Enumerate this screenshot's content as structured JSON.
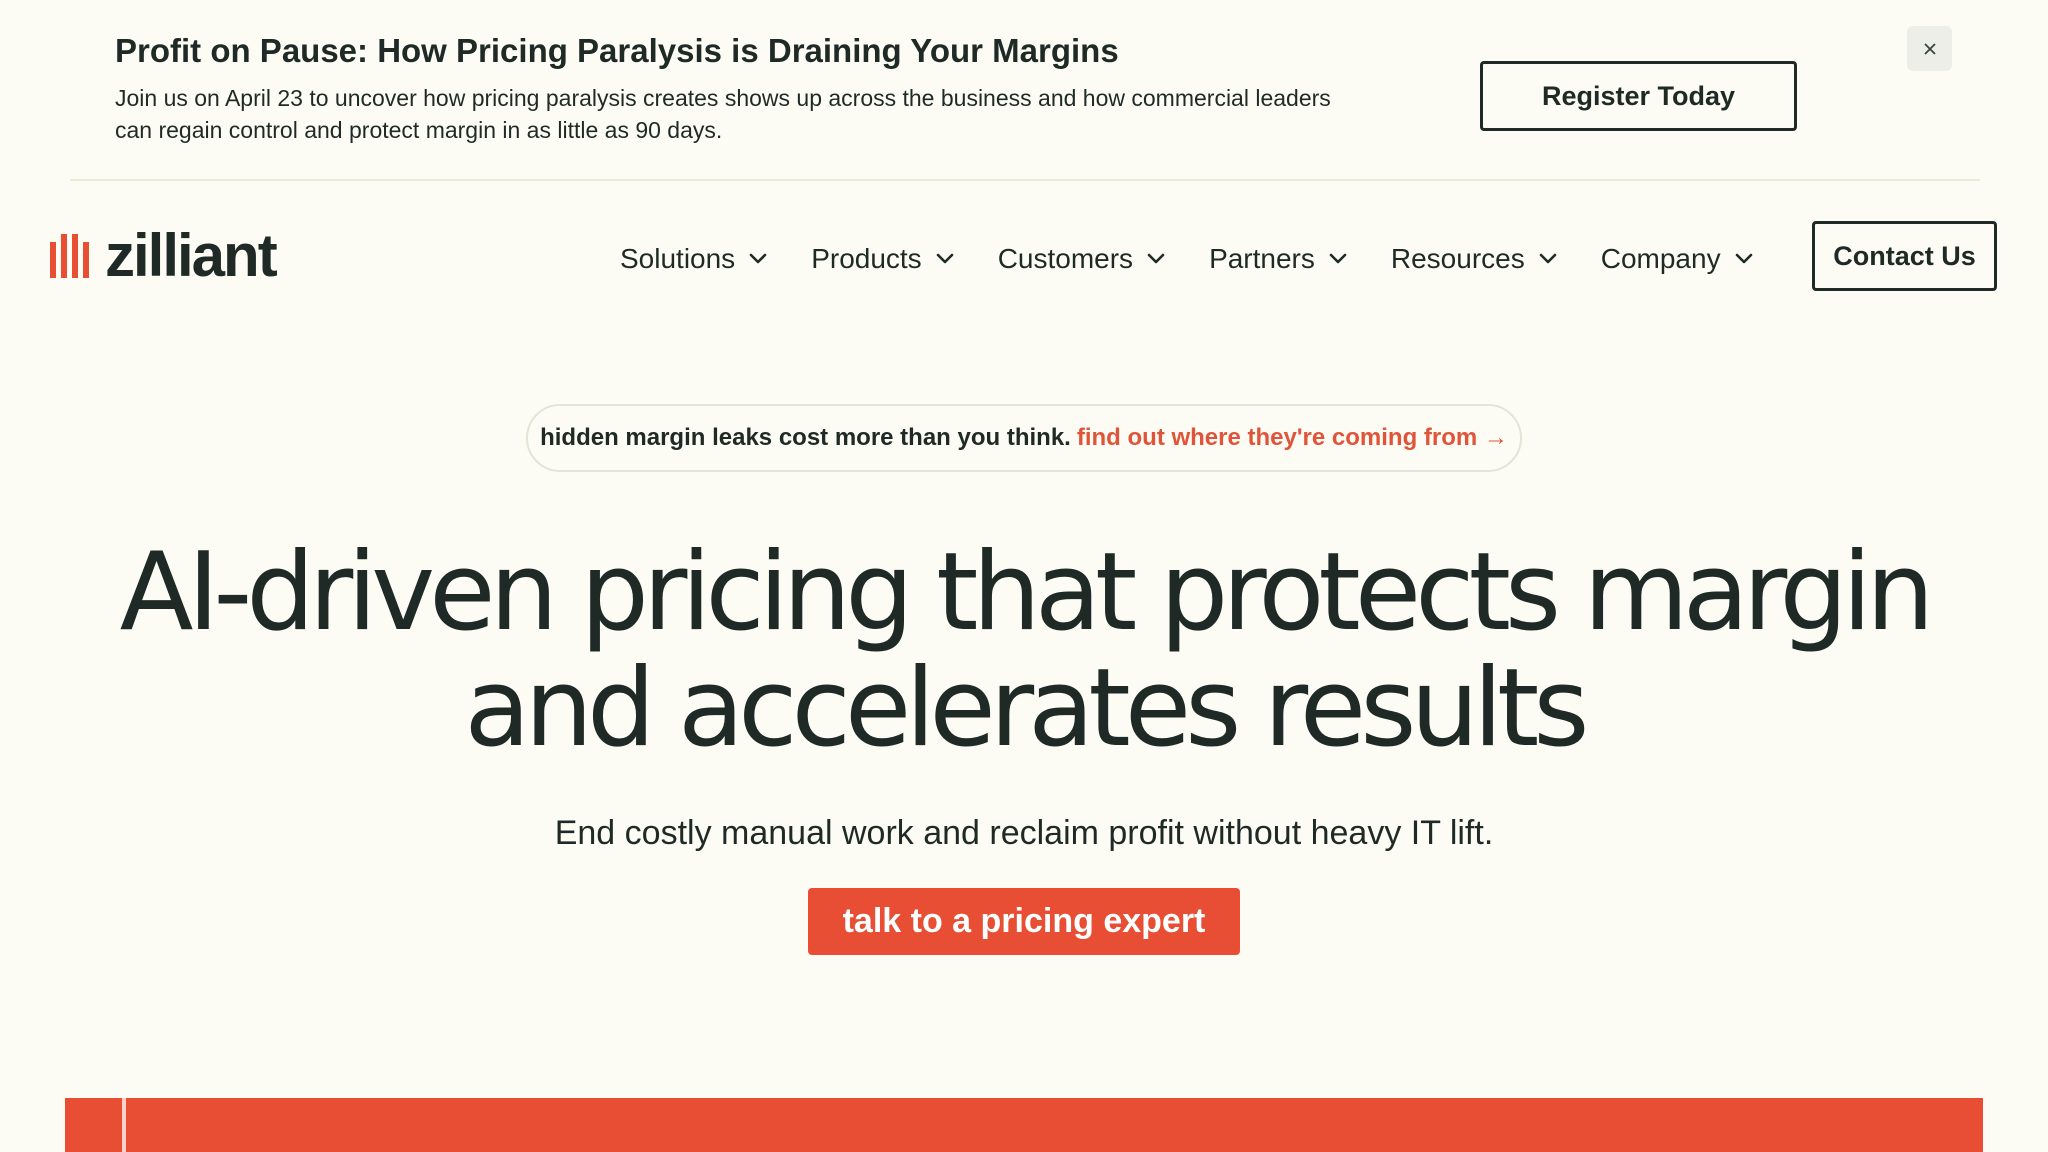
{
  "banner": {
    "title": "Profit on Pause: How Pricing Paralysis is Draining Your Margins",
    "description": "Join us on April 23 to uncover how pricing paralysis creates shows up across the business and how commercial leaders can regain control and protect margin in as little as 90 days.",
    "register_label": "Register Today",
    "close_icon": "close-icon"
  },
  "nav": {
    "logo_text": "zilliant",
    "items": [
      {
        "label": "Solutions"
      },
      {
        "label": "Products"
      },
      {
        "label": "Customers"
      },
      {
        "label": "Partners"
      },
      {
        "label": "Resources"
      },
      {
        "label": "Company"
      }
    ],
    "contact_label": "Contact Us"
  },
  "hero": {
    "pill_text": "hidden margin leaks cost more than you think.",
    "pill_link": "find out where they're coming from →",
    "headline_line1": "AI-driven pricing that protects margin",
    "headline_line2": "and accelerates results",
    "subhead": "End costly manual work and reclaim profit without heavy IT lift.",
    "cta_label": "talk to a pricing expert"
  },
  "colors": {
    "background": "#fcfcf5",
    "text": "#1f2a27",
    "accent": "#e84e34",
    "link": "#e0553a"
  }
}
